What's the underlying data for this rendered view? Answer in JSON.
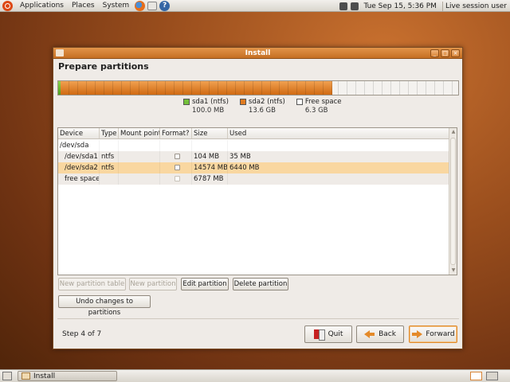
{
  "top_panel": {
    "menus": [
      "Applications",
      "Places",
      "System"
    ],
    "datetime": "Tue Sep 15,  5:36 PM",
    "session": "Live session user"
  },
  "window": {
    "title": "Install",
    "page_title": "Prepare partitions",
    "partition_bar": {
      "segments": [
        {
          "name": "sda1",
          "fraction": 0.005,
          "color": "#73c03a"
        },
        {
          "name": "sda2",
          "fraction": 0.68,
          "color": "#e07b20"
        },
        {
          "name": "free",
          "fraction": 0.315,
          "color": "#f4f2ef"
        }
      ]
    },
    "legend": [
      {
        "label": "sda1 (ntfs)",
        "size": "100.0 MB",
        "color": "#73c03a"
      },
      {
        "label": "sda2 (ntfs)",
        "size": "13.6 GB",
        "color": "#e07b20"
      },
      {
        "label": "Free space",
        "size": "6.3 GB",
        "color": "#ffffff"
      }
    ],
    "table": {
      "headers": [
        "Device",
        "Type",
        "Mount point",
        "Format?",
        "Size",
        "Used"
      ],
      "rows": [
        {
          "device": "/dev/sda",
          "type": "",
          "mount": "",
          "format": false,
          "size": "",
          "used": ""
        },
        {
          "device": "/dev/sda1",
          "type": "ntfs",
          "mount": "",
          "format": true,
          "size": "104 MB",
          "used": "35 MB"
        },
        {
          "device": "/dev/sda2",
          "type": "ntfs",
          "mount": "",
          "format": true,
          "size": "14574 MB",
          "used": "6440 MB"
        },
        {
          "device": "free space",
          "type": "",
          "mount": "",
          "format": true,
          "size": "6787 MB",
          "used": ""
        }
      ]
    },
    "buttons": {
      "new_table": "New partition table",
      "new_partition": "New partition",
      "edit_partition": "Edit partition",
      "delete_partition": "Delete partition",
      "undo": "Undo changes to partitions"
    },
    "step": "Step 4 of 7",
    "nav": {
      "quit": "Quit",
      "back": "Back",
      "forward": "Forward"
    }
  },
  "taskbar": {
    "task": "Install"
  }
}
